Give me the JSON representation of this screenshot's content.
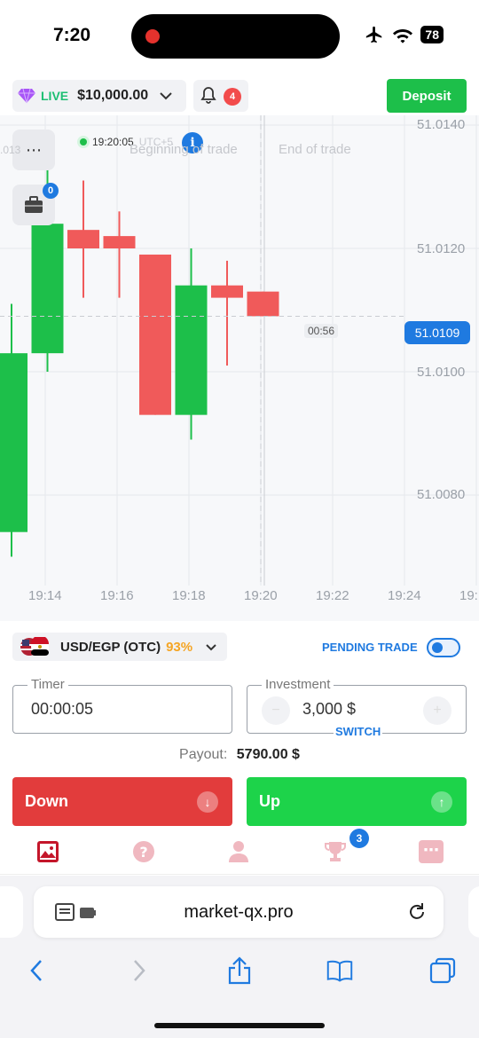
{
  "status_bar": {
    "time": "7:20",
    "battery": "78"
  },
  "header": {
    "account_mode": "LIVE",
    "balance": "$10,000.00",
    "notifications_count": "4",
    "deposit_label": "Deposit"
  },
  "chart": {
    "menu_icon": "⋯",
    "portfolio_count": "0",
    "server_time": "19:20:05",
    "server_timezone": "UTC+5",
    "info_icon_text": "i",
    "beginning_label": "Beginning of trade",
    "end_label": "End of trade",
    "current_price": "51.0109",
    "countdown": "00:56",
    "left_partial_price": ".013",
    "y_ticks": [
      "51.0140",
      "51.0120",
      "51.0100",
      "51.0080"
    ],
    "x_ticks": [
      "19:14",
      "19:16",
      "19:18",
      "19:20",
      "19:22",
      "19:24",
      "19:"
    ]
  },
  "chart_data": {
    "type": "candlestick",
    "y_ticks": [
      51.014,
      51.012,
      51.01,
      51.008
    ],
    "x_ticks": [
      "19:14",
      "19:16",
      "19:18",
      "19:20",
      "19:22",
      "19:24"
    ],
    "current_price": 51.0109,
    "candles": [
      {
        "dir": "up",
        "open": 51.0074,
        "close": 51.0103,
        "high": 51.0111,
        "low": 51.007
      },
      {
        "dir": "up",
        "open": 51.0103,
        "close": 51.0124,
        "high": 51.0137,
        "low": 51.01
      },
      {
        "dir": "down",
        "open": 51.0123,
        "close": 51.012,
        "high": 51.0131,
        "low": 51.0112
      },
      {
        "dir": "down",
        "open": 51.0122,
        "close": 51.012,
        "high": 51.0126,
        "low": 51.0112
      },
      {
        "dir": "down",
        "open": 51.0119,
        "close": 51.0093,
        "high": 51.0119,
        "low": 51.0093
      },
      {
        "dir": "up",
        "open": 51.0093,
        "close": 51.0114,
        "high": 51.012,
        "low": 51.0089
      },
      {
        "dir": "down",
        "open": 51.0114,
        "close": 51.0112,
        "high": 51.0118,
        "low": 51.0101
      },
      {
        "dir": "down",
        "open": 51.0113,
        "close": 51.0109,
        "high": 51.0113,
        "low": 51.0109
      }
    ]
  },
  "asset": {
    "name": "USD/EGP (OTC)",
    "payout_pct": "93%"
  },
  "pending": {
    "label": "PENDING TRADE"
  },
  "timer": {
    "label": "Timer",
    "value": "00:00:05"
  },
  "investment": {
    "label": "Investment",
    "value": "3,000 $",
    "minus": "−",
    "plus": "+",
    "switch_label": "SWITCH"
  },
  "payout": {
    "label": "Payout:",
    "value": "5790.00 $"
  },
  "buttons": {
    "down_label": "Down",
    "up_label": "Up",
    "down_arrow": "↓",
    "up_arrow": "↑"
  },
  "app_nav": {
    "trophy_badge": "3",
    "more_icon": "⋯"
  },
  "safari": {
    "url": "market-qx.pro"
  },
  "colors": {
    "green": "#1dbf4a",
    "red": "#f05a5a",
    "blue": "#1f7ae0",
    "orange": "#f5a524"
  }
}
